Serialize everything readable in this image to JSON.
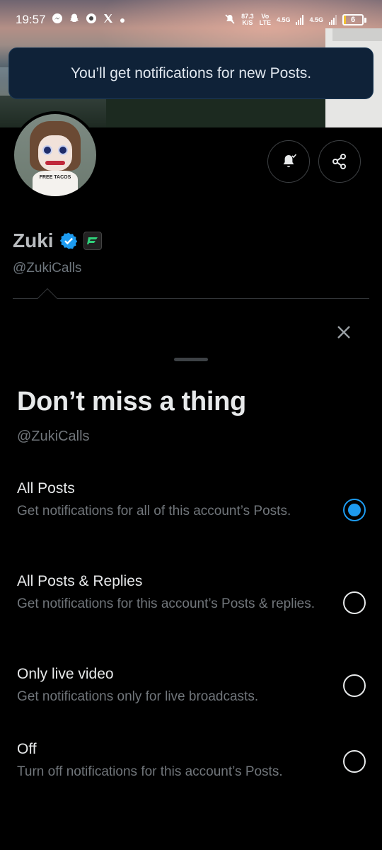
{
  "status_bar": {
    "time": "19:57",
    "speed_value": "87.3",
    "speed_unit": "K/S",
    "volte_top": "Vo",
    "volte_bottom": "LTE",
    "net1": "4.5G",
    "net2": "4.5G",
    "battery": "6",
    "battery_level": 0.06,
    "notif_icons": [
      "messenger-icon",
      "snapchat-icon",
      "chrome-like-icon",
      "x-icon",
      "dot-icon"
    ]
  },
  "toast": {
    "message": "You’ll get notifications for new Posts."
  },
  "profile": {
    "name": "Zuki",
    "handle": "@ZukiCalls",
    "avatar_shirt_text": "FREE TACOS"
  },
  "colors": {
    "accent": "#1d9bf0",
    "toast_bg": "#0f2238",
    "secondary_text": "#71767b"
  },
  "sheet": {
    "title": "Don’t miss a thing",
    "handle": "@ZukiCalls",
    "options": [
      {
        "title": "All Posts",
        "description": "Get notifications for all of this account’s Posts.",
        "selected": true
      },
      {
        "title": "All Posts & Replies",
        "description": "Get notifications for this account’s Posts & replies.",
        "selected": false
      },
      {
        "title": "Only live video",
        "description": "Get notifications only for live broadcasts.",
        "selected": false
      },
      {
        "title": "Off",
        "description": "Turn off notifications for this account’s Posts.",
        "selected": false
      }
    ]
  }
}
